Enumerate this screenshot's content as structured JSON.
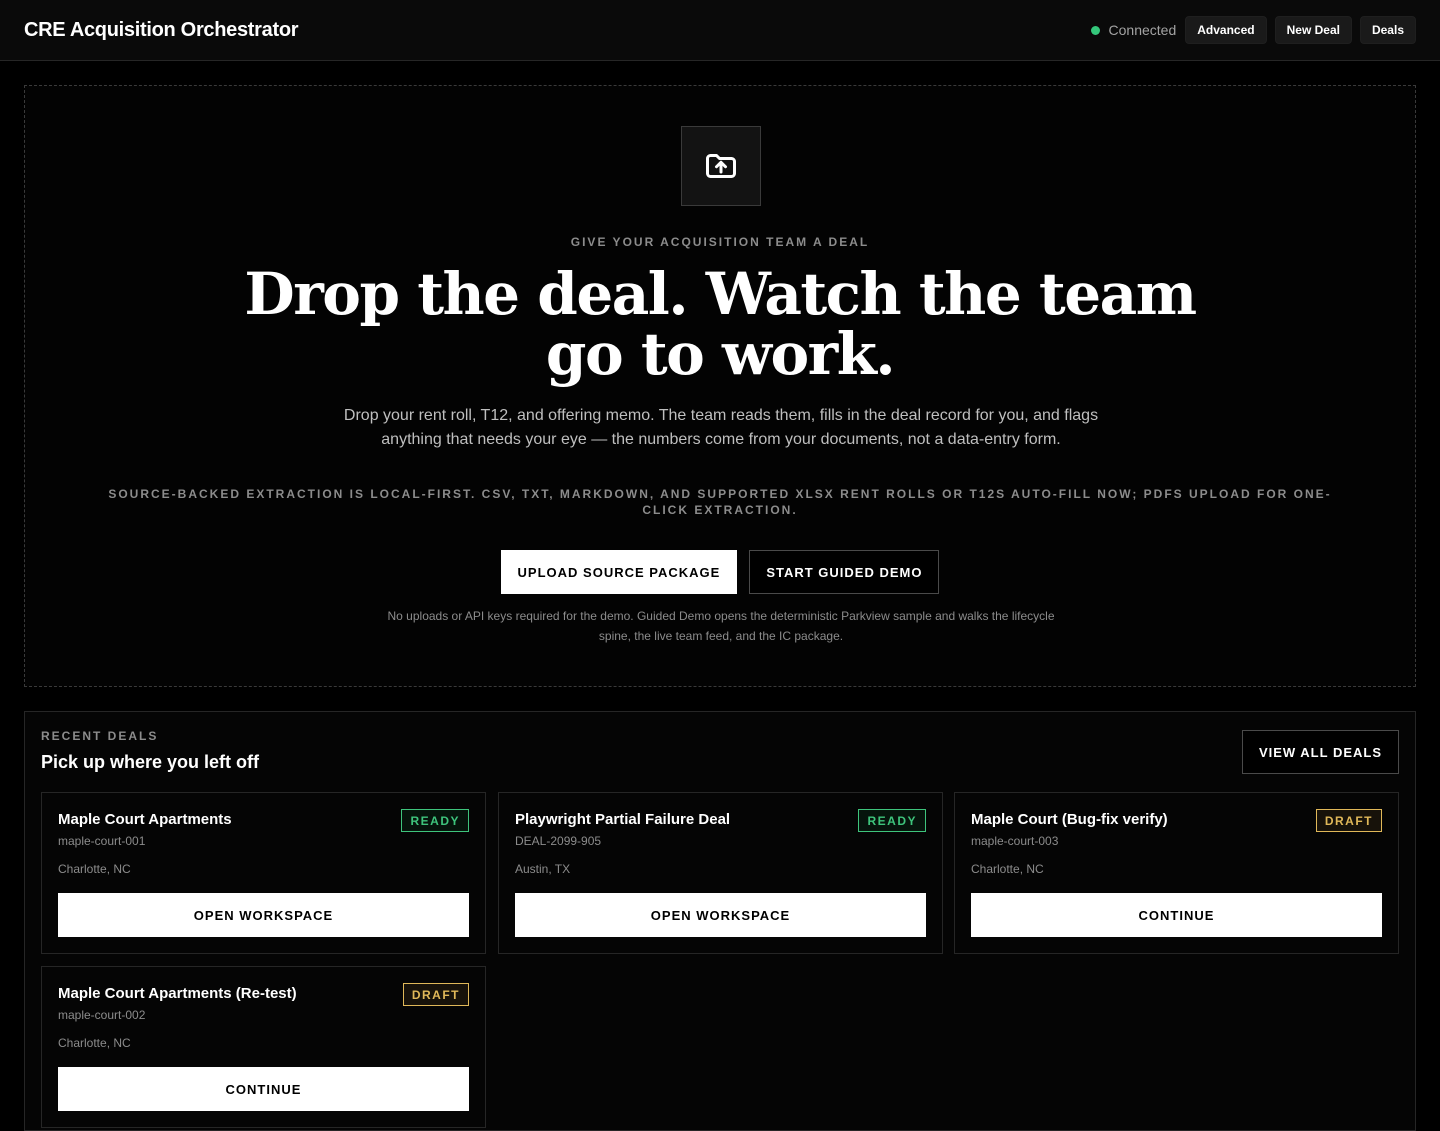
{
  "header": {
    "title": "CRE Acquisition Orchestrator",
    "status": "Connected",
    "nav": [
      "Advanced",
      "New Deal",
      "Deals"
    ]
  },
  "hero": {
    "icon": "folder-upload-icon",
    "eyebrow": "GIVE YOUR ACQUISITION TEAM A DEAL",
    "headline_line1": "Drop the deal. Watch the team",
    "headline_line2": "go to work.",
    "lead": "Drop your rent roll, T12, and offering memo. The team reads them, fills in the deal record for you, and flags anything that needs your eye — the numbers come from your documents, not a data-entry form.",
    "fineprint": "SOURCE-BACKED EXTRACTION IS LOCAL-FIRST. CSV, TXT, MARKDOWN, AND SUPPORTED XLSX RENT ROLLS OR T12S AUTO-FILL NOW; PDFS UPLOAD FOR ONE-CLICK EXTRACTION.",
    "upload_label": "UPLOAD SOURCE PACKAGE",
    "demo_label": "START GUIDED DEMO",
    "demo_note": "No uploads or API keys required for the demo. Guided Demo opens the deterministic Parkview sample and walks the lifecycle spine, the live team feed, and the IC package."
  },
  "recent": {
    "eyebrow": "RECENT DEALS",
    "title": "Pick up where you left off",
    "view_all": "VIEW ALL DEALS",
    "deals": [
      {
        "name": "Maple Court Apartments",
        "id": "maple-court-001",
        "location": "Charlotte, NC",
        "status": "READY",
        "action": "OPEN WORKSPACE"
      },
      {
        "name": "Playwright Partial Failure Deal",
        "id": "DEAL-2099-905",
        "location": "Austin, TX",
        "status": "READY",
        "action": "OPEN WORKSPACE"
      },
      {
        "name": "Maple Court (Bug-fix verify)",
        "id": "maple-court-003",
        "location": "Charlotte, NC",
        "status": "DRAFT",
        "action": "CONTINUE"
      },
      {
        "name": "Maple Court Apartments (Re-test)",
        "id": "maple-court-002",
        "location": "Charlotte, NC",
        "status": "DRAFT",
        "action": "CONTINUE"
      }
    ]
  },
  "colors": {
    "background": "#000000",
    "ready": "#3ec47c",
    "draft": "#e0b859",
    "connected": "#34c77b"
  }
}
